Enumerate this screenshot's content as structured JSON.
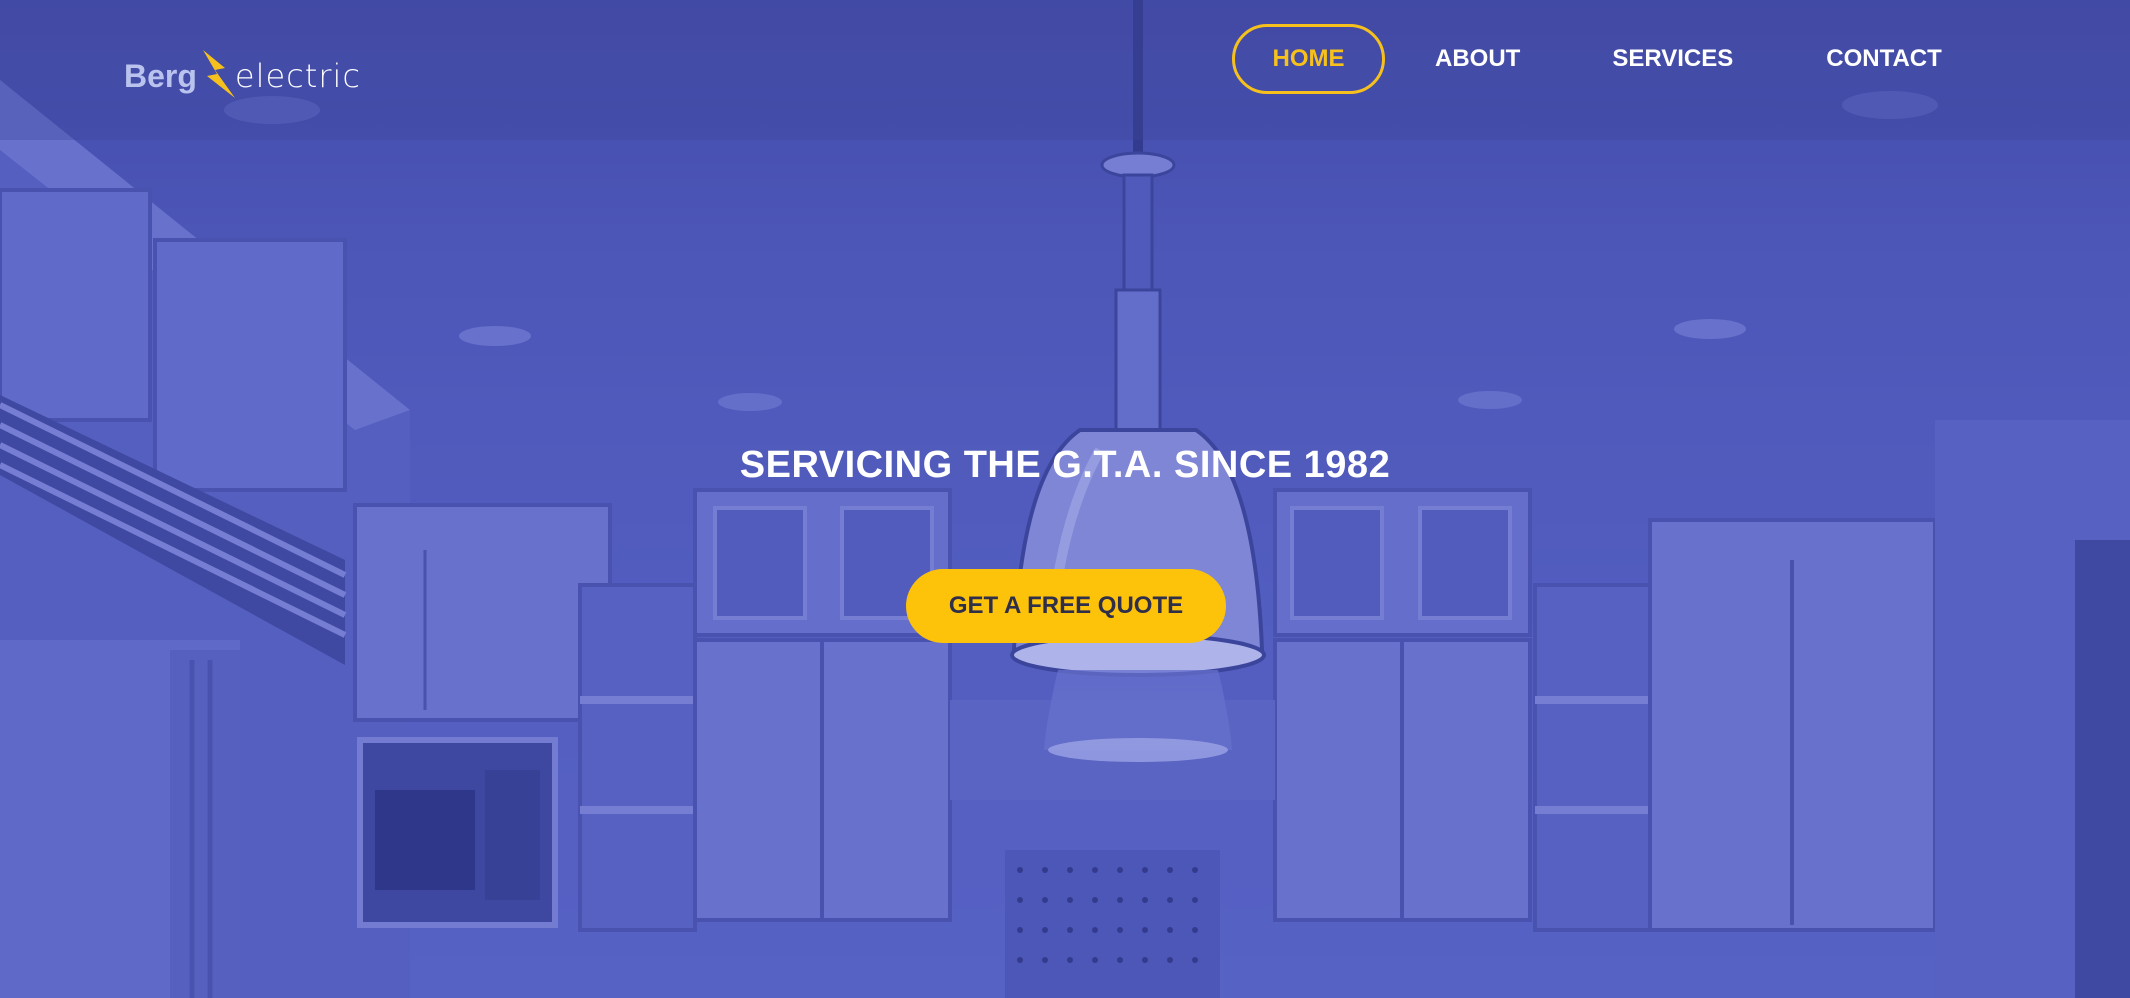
{
  "logo": {
    "part_one": "Berg",
    "part_two": "electric",
    "bolt_icon": "lightning-bolt-icon",
    "colors": {
      "part_one": "#b9c3ee",
      "bolt": "#f6c11d",
      "part_two": "#ffffff"
    }
  },
  "nav": {
    "items": [
      {
        "label": "HOME",
        "active": true
      },
      {
        "label": "ABOUT",
        "active": false
      },
      {
        "label": "SERVICES",
        "active": false
      },
      {
        "label": "CONTACT",
        "active": false
      }
    ]
  },
  "hero": {
    "tagline": "SERVICING THE G.T.A. SINCE 1982",
    "cta_label": "GET A FREE QUOTE",
    "background_image": "kitchen-with-pendant-lamp",
    "overlay_color": "#4b55b4"
  },
  "colors": {
    "accent": "#f6c11d",
    "cta_background": "#fdc30a",
    "cta_text": "#2f2f4a",
    "text": "#ffffff"
  }
}
